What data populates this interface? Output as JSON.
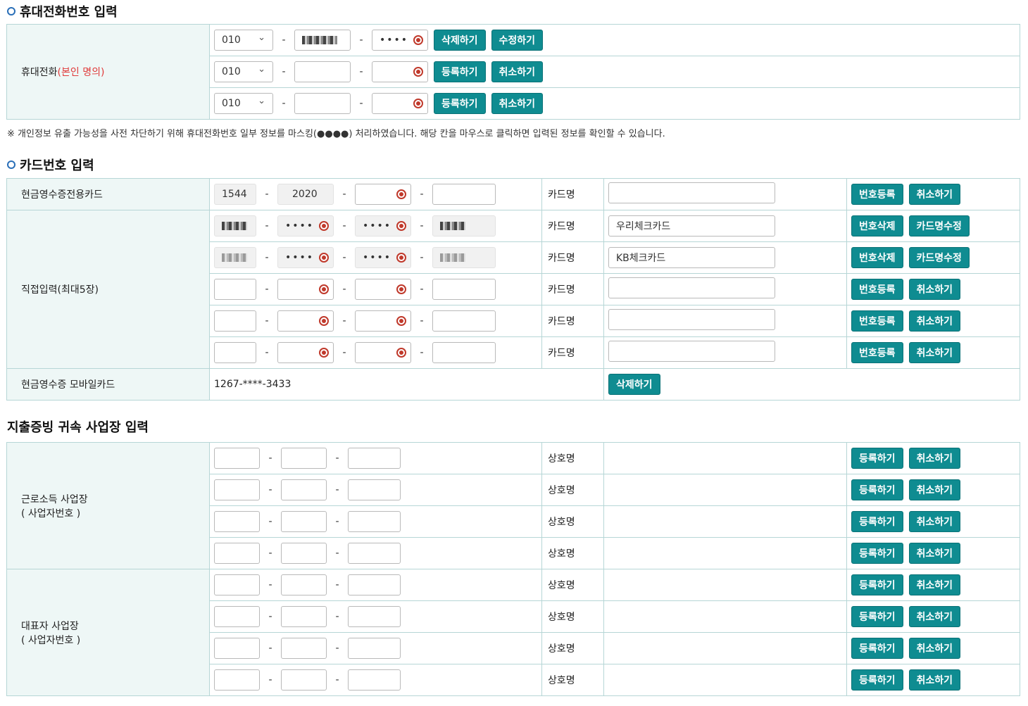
{
  "phone_section": {
    "title": "휴대전화번호 입력",
    "label": "휴대전화",
    "label_suffix": "(본인 명의)",
    "rows": [
      {
        "prefix": "010",
        "mid": "",
        "last": "••••",
        "btn1": "삭제하기",
        "btn2": "수정하기"
      },
      {
        "prefix": "010",
        "mid": "",
        "last": "",
        "btn1": "등록하기",
        "btn2": "취소하기"
      },
      {
        "prefix": "010",
        "mid": "",
        "last": "",
        "btn1": "등록하기",
        "btn2": "취소하기"
      }
    ],
    "note": "※ 개인정보 유출 가능성을 사전 차단하기 위해 휴대전화번호 일부 정보를 마스킹(●●●●) 처리하였습니다. 해당 칸을 마우스로 클릭하면 입력된 정보를 확인할 수 있습니다."
  },
  "card_section": {
    "title": "카드번호 입력",
    "cash_card_label": "현금영수증전용카드",
    "cash_card_row": {
      "p1": "1544",
      "p2": "2020",
      "p3": "",
      "p4": "",
      "cardname_label": "카드명",
      "cardname": "",
      "btn1": "번호등록",
      "btn2": "취소하기"
    },
    "direct_label": "직접입력(최대5장)",
    "direct_rows": [
      {
        "p2": "••••",
        "p3": "••••",
        "cardname_label": "카드명",
        "cardname": "우리체크카드",
        "btn1": "번호삭제",
        "btn2": "카드명수정"
      },
      {
        "p2": "••••",
        "p3": "••••",
        "cardname_label": "카드명",
        "cardname": "KB체크카드",
        "btn1": "번호삭제",
        "btn2": "카드명수정"
      },
      {
        "p2": "",
        "p3": "",
        "cardname_label": "카드명",
        "cardname": "",
        "btn1": "번호등록",
        "btn2": "취소하기"
      },
      {
        "p2": "",
        "p3": "",
        "cardname_label": "카드명",
        "cardname": "",
        "btn1": "번호등록",
        "btn2": "취소하기"
      },
      {
        "p2": "",
        "p3": "",
        "cardname_label": "카드명",
        "cardname": "",
        "btn1": "번호등록",
        "btn2": "취소하기"
      }
    ],
    "mobile_label": "현금영수증 모바일카드",
    "mobile_value": "1267-****-3433",
    "mobile_btn": "삭제하기"
  },
  "biz_section": {
    "title": "지출증빙 귀속 사업장 입력",
    "groups": [
      {
        "label1": "근로소득 사업장",
        "label2": "( 사업자번호 )"
      },
      {
        "label1": "대표자 사업장",
        "label2": "( 사업자번호 )"
      }
    ],
    "name_label": "상호명",
    "btn1": "등록하기",
    "btn2": "취소하기"
  },
  "dash": "-",
  "colors": {
    "accent": "#0f8c91",
    "label_bg": "#eef7f6",
    "border": "#b6d6d6",
    "highlight": "#e03a3a"
  }
}
